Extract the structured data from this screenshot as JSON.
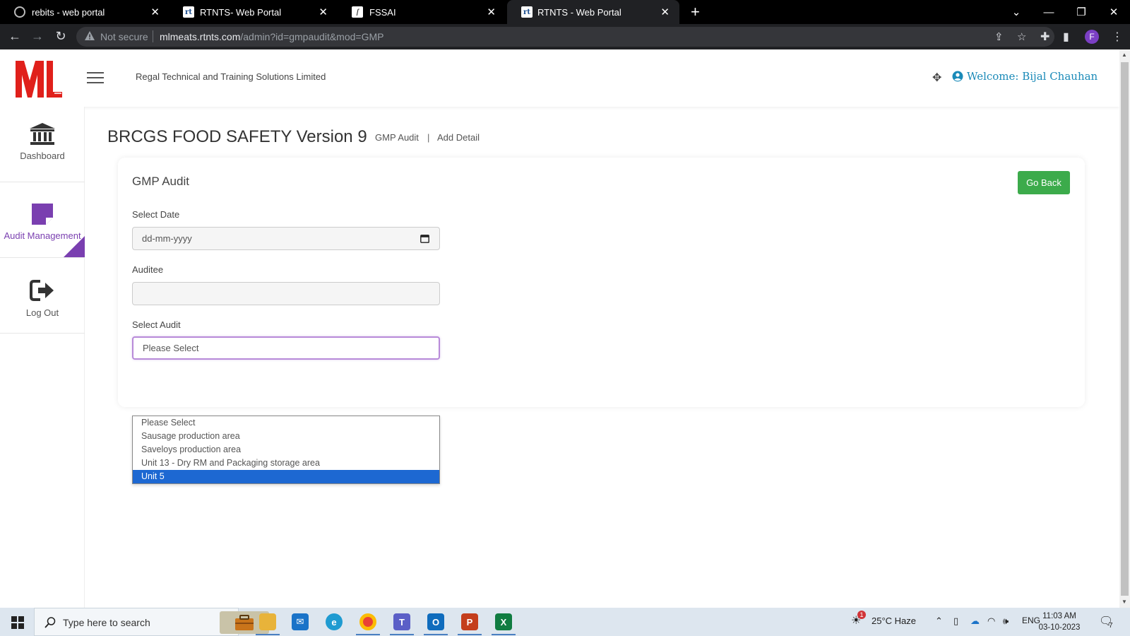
{
  "browser": {
    "tabs": [
      {
        "title": "rebits - web portal",
        "favicon": "globe-icon"
      },
      {
        "title": "RTNTS- Web Portal",
        "favicon": "rt-icon"
      },
      {
        "title": "FSSAI",
        "favicon": "fssai-icon"
      },
      {
        "title": "RTNTS - Web Portal",
        "favicon": "rt-icon"
      }
    ],
    "security_label": "Not secure",
    "url_host": "mlmeats.rtnts.com",
    "url_path": "/admin?id=gmpaudit&mod=GMP",
    "profile_initial": "F"
  },
  "header": {
    "logo_text": "ML",
    "company": "Regal Technical and Training Solutions Limited",
    "welcome": "Welcome: Bijal Chauhan"
  },
  "sidebar": {
    "items": [
      {
        "label": "Dashboard",
        "icon": "bank-icon"
      },
      {
        "label": "Audit Management",
        "icon": "note-icon",
        "active": true
      },
      {
        "label": "Log Out",
        "icon": "logout-icon"
      }
    ]
  },
  "main": {
    "page_title": "BRCGS FOOD SAFETY Version 9",
    "breadcrumb": [
      "GMP Audit",
      "|",
      "Add Detail"
    ],
    "card_title": "GMP Audit",
    "go_back": "Go Back",
    "date_label": "Select Date",
    "date_placeholder": "dd-mm-yyyy",
    "auditee_label": "Auditee",
    "auditee_value": "",
    "audit_label": "Select Audit",
    "audit_value": "Please Select",
    "audit_options": [
      "Please Select",
      "Sausage production area",
      "Saveloys production area",
      "Unit 13 - Dry RM and Packaging storage area",
      "Unit 5"
    ],
    "highlighted_option": "Unit 5"
  },
  "taskbar": {
    "search_placeholder": "Type here to search",
    "weather": "25°C  Haze",
    "weather_badge": "1",
    "language": "ENG",
    "time": "11:03 AM",
    "date": "03-10-2023",
    "notifications": "7"
  },
  "colors": {
    "accent_purple": "#7a3fb0",
    "go_back_green": "#3cab4b",
    "welcome_blue": "#1a8ab8",
    "logo_red": "#e0201b",
    "highlight_blue": "#1d68d2"
  }
}
